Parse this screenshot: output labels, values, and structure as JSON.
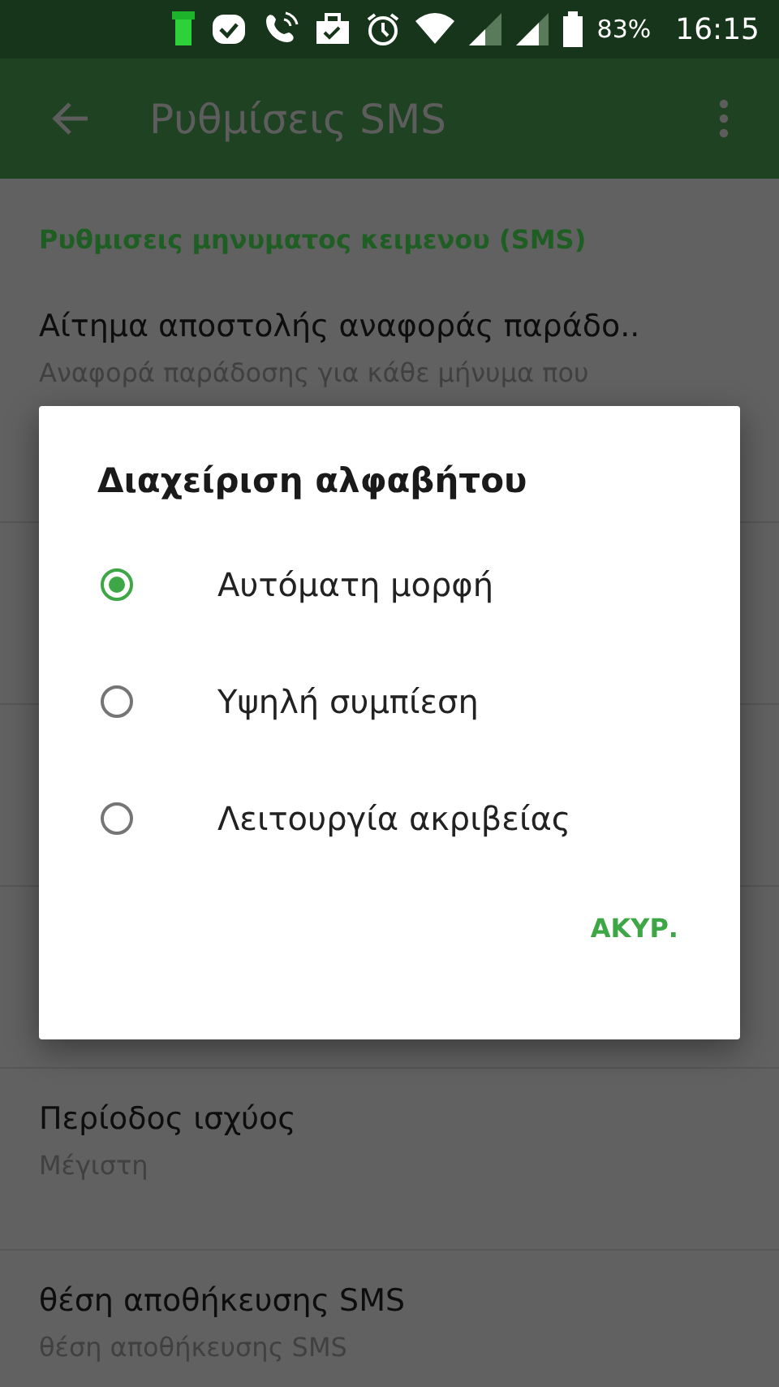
{
  "status_bar": {
    "battery": "83%",
    "time": "16:15"
  },
  "app_bar": {
    "title": "Ρυθμίσεις SMS"
  },
  "section_header": "Ρυθμισεις μηνυματος κειμενου (SMS)",
  "settings": [
    {
      "title": "Αίτημα αποστολής αναφοράς παράδο..",
      "summary": "Αναφορά παράδοσης για κάθε μήνυμα που"
    },
    {
      "title": "Περίοδος ισχύος",
      "summary": "Μέγιστη"
    },
    {
      "title": "θέση αποθήκευσης SMS",
      "summary": "θέση αποθήκευσης SMS"
    }
  ],
  "dialog": {
    "title": "Διαχείριση αλφαβήτου",
    "options": [
      {
        "label": "Αυτόματη μορφή",
        "selected": true
      },
      {
        "label": "Υψηλή συμπίεση",
        "selected": false
      },
      {
        "label": "Λειτουργία ακριβείας",
        "selected": false
      }
    ],
    "buttons": [
      "ΑΚΥΡ."
    ]
  }
}
